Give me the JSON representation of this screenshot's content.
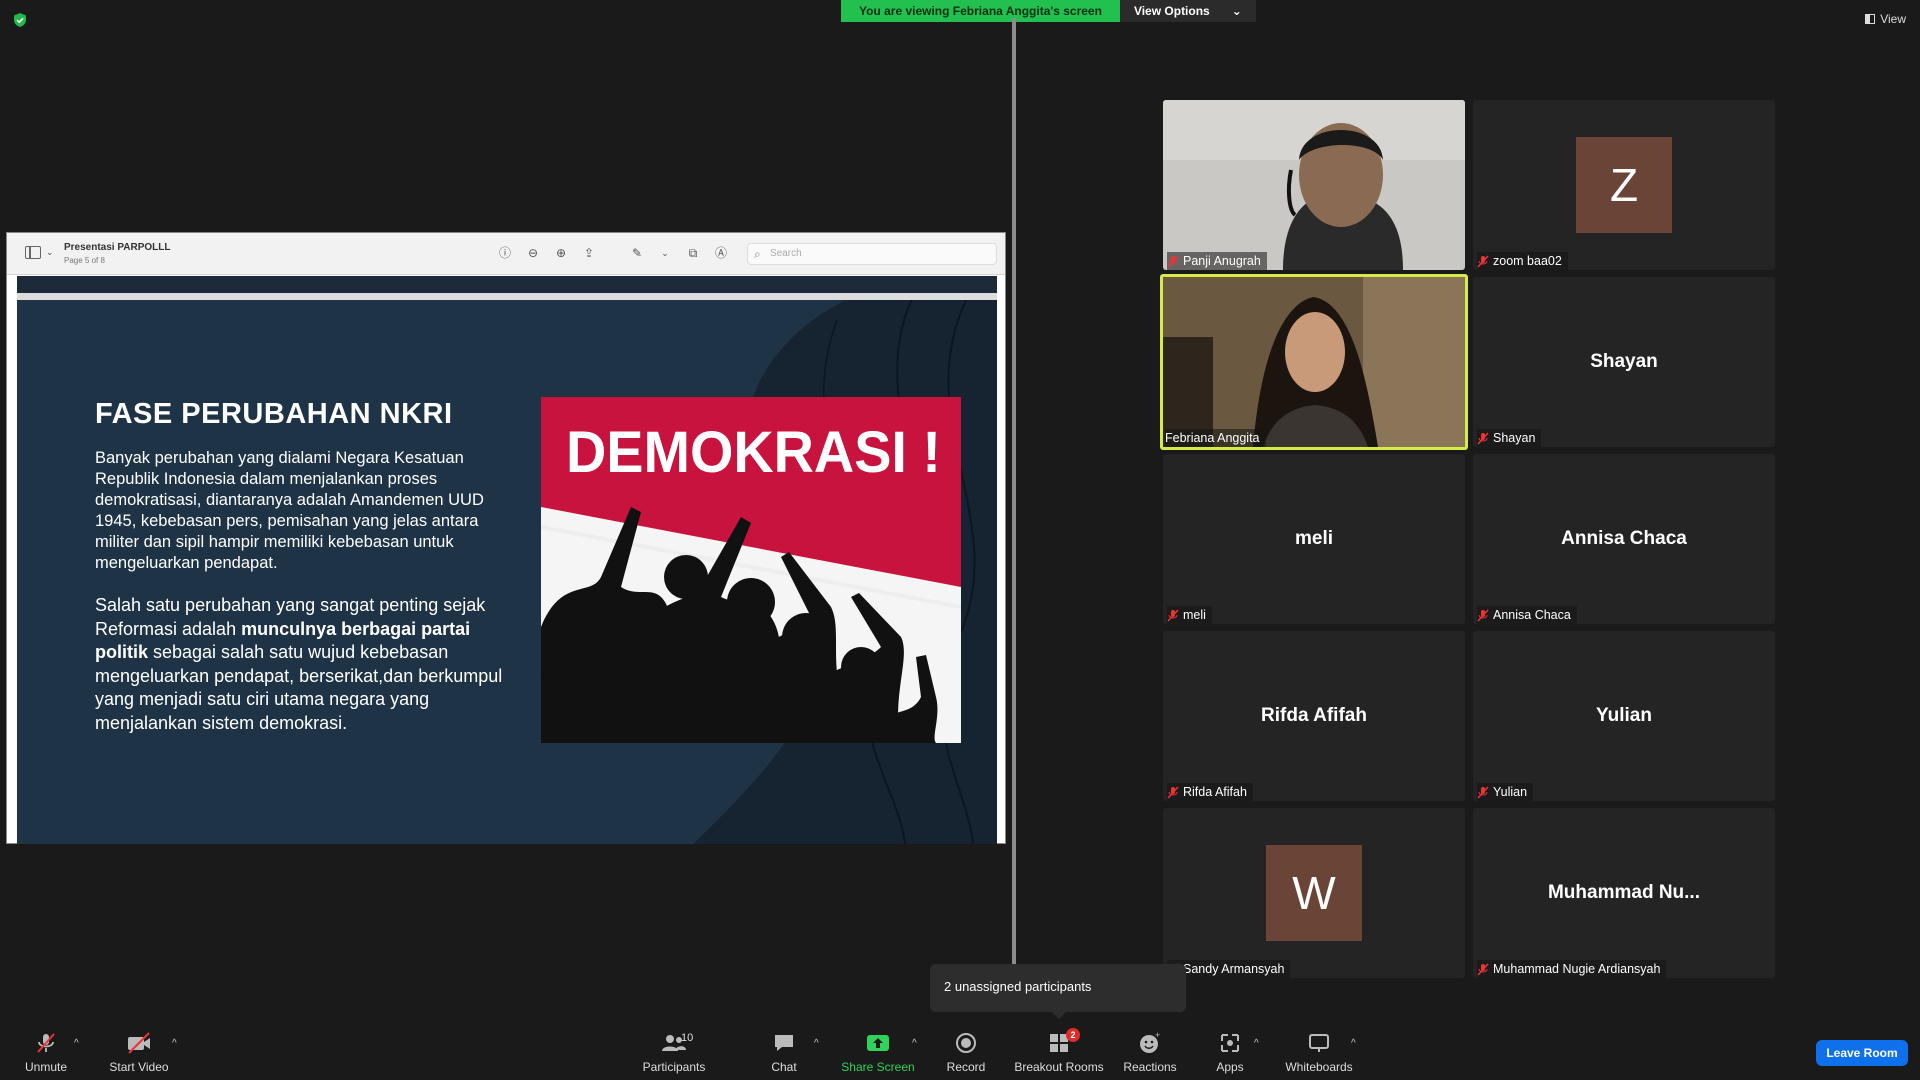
{
  "banner": {
    "viewing_text": "You are viewing Febriana Anggita's screen",
    "view_options": "View Options"
  },
  "top_right": {
    "view": "View"
  },
  "pdf": {
    "title": "Presentasi PARPOLLL",
    "page": "Page 5 of 8",
    "search_placeholder": "Search"
  },
  "slide": {
    "title": "FASE PERUBAHAN NKRI",
    "paragraph1": "Banyak perubahan yang dialami Negara Kesatuan Republik Indonesia dalam menjalankan proses demokratisasi, diantaranya adalah Amandemen UUD 1945, kebebasan pers, pemisahan yang jelas antara militer dan sipil hampir memiliki kebebasan untuk mengeluarkan pendapat.",
    "paragraph2_a": " Salah satu perubahan yang sangat penting sejak Reformasi adalah ",
    "paragraph2_bold": "munculnya berbagai partai politik",
    "paragraph2_b": " sebagai salah satu wujud kebebasan mengeluarkan pendapat, berserikat,dan berkumpul yang menjadi satu ciri utama negara yang menjalankan sistem demokrasi.",
    "image_text": "DEMOKRASI !"
  },
  "participants": [
    {
      "name": "Panji Anugrah",
      "type": "video"
    },
    {
      "name": "zoom baa02",
      "type": "avatar",
      "initial": "Z"
    },
    {
      "name": "Febriana Anggita",
      "type": "video",
      "active": true
    },
    {
      "name": "Shayan",
      "type": "name",
      "center": "Shayan"
    },
    {
      "name": "meli",
      "type": "name",
      "center": "meli"
    },
    {
      "name": "Annisa Chaca",
      "type": "name",
      "center": "Annisa Chaca"
    },
    {
      "name": "Rifda Afifah",
      "type": "name",
      "center": "Rifda Afifah"
    },
    {
      "name": "Yulian",
      "type": "name",
      "center": "Yulian"
    },
    {
      "name": "Sandy Armansyah",
      "type": "avatar",
      "initial": "W"
    },
    {
      "name": "Muhammad Nugie Ardiansyah",
      "type": "name",
      "center": "Muhammad  Nu..."
    }
  ],
  "popover": {
    "text": "2 unassigned participants"
  },
  "toolbar": {
    "unmute": "Unmute",
    "start_video": "Start Video",
    "participants": "Participants",
    "participants_count": "10",
    "chat": "Chat",
    "share_screen": "Share Screen",
    "record": "Record",
    "breakout_rooms": "Breakout Rooms",
    "breakout_badge": "2",
    "reactions": "Reactions",
    "apps": "Apps",
    "whiteboards": "Whiteboards",
    "leave": "Leave Room"
  },
  "colors": {
    "share_green": "#21c04f",
    "leave_blue": "#0e71eb",
    "active_border": "#d6ea4a",
    "avatar_brown": "#6b4438"
  }
}
